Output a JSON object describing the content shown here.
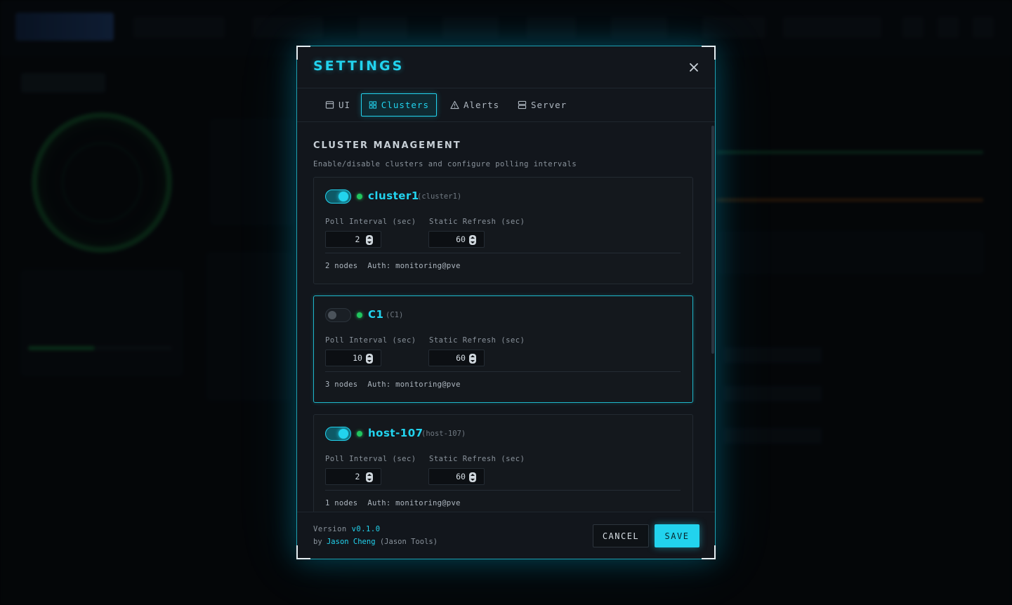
{
  "modal": {
    "title": "SETTINGS",
    "tabs": [
      {
        "label": "UI",
        "icon": "window-icon",
        "active": false
      },
      {
        "label": "Clusters",
        "icon": "grid-icon",
        "active": true
      },
      {
        "label": "Alerts",
        "icon": "warning-triangle-icon",
        "active": false
      },
      {
        "label": "Server",
        "icon": "server-icon",
        "active": false
      }
    ],
    "section": {
      "title": "CLUSTER MANAGEMENT",
      "subtitle": "Enable/disable clusters and configure polling intervals"
    },
    "field_labels": {
      "poll": "Poll Interval (sec)",
      "static": "Static Refresh (sec)"
    },
    "clusters": [
      {
        "name": "cluster1",
        "id": "(cluster1)",
        "enabled": true,
        "status": "online",
        "poll": "2",
        "static": "60",
        "nodes": "2 nodes",
        "auth": "Auth: monitoring@pve"
      },
      {
        "name": "C1",
        "id": "(C1)",
        "enabled": false,
        "status": "online",
        "poll": "10",
        "static": "60",
        "nodes": "3 nodes",
        "auth": "Auth: monitoring@pve"
      },
      {
        "name": "host-107",
        "id": "(host-107)",
        "enabled": true,
        "status": "online",
        "poll": "2",
        "static": "60",
        "nodes": "1 nodes",
        "auth": "Auth: monitoring@pve"
      }
    ],
    "footer": {
      "version_label": "Version",
      "version": "v0.1.0",
      "by_label": "by",
      "author": "Jason Cheng",
      "org": "(Jason Tools)",
      "cancel": "CANCEL",
      "save": "SAVE"
    }
  },
  "colors": {
    "accent": "#22d3ee",
    "status_online": "#22c55e",
    "modal_bg": "#12161c"
  }
}
